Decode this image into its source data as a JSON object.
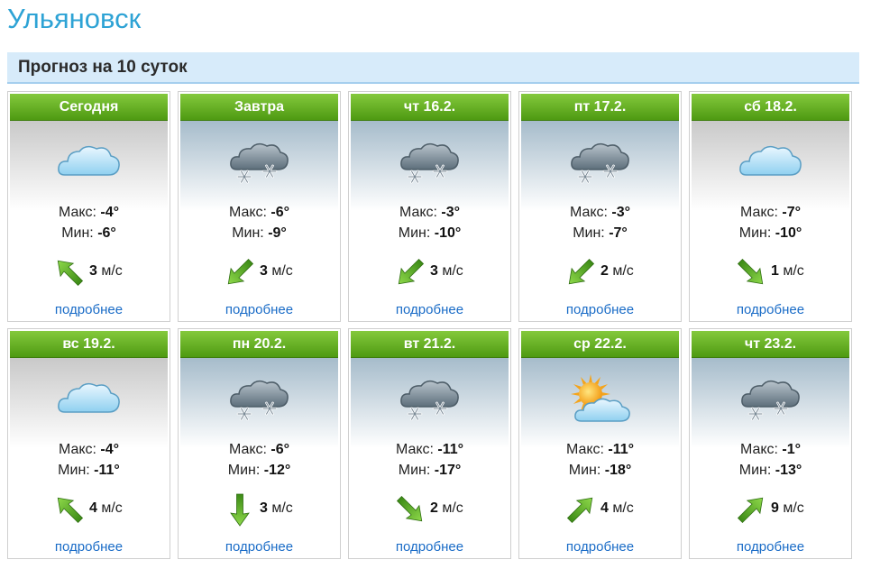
{
  "city": "Ульяновск",
  "section_title": "Прогноз на 10 суток",
  "labels": {
    "max": "Макс:",
    "min": "Мин:",
    "speed_unit": "м/с",
    "details": "подробнее"
  },
  "days": [
    {
      "date": "Сегодня",
      "icon": "cloud-icon",
      "max": "-4°",
      "min": "-6°",
      "wind_dir": "northwest",
      "wind": "3"
    },
    {
      "date": "Завтра",
      "icon": "snow-cloud-icon",
      "max": "-6°",
      "min": "-9°",
      "wind_dir": "southwest",
      "wind": "3"
    },
    {
      "date": "чт 16.2.",
      "icon": "snow-cloud-icon",
      "max": "-3°",
      "min": "-10°",
      "wind_dir": "southwest",
      "wind": "3"
    },
    {
      "date": "пт 17.2.",
      "icon": "snow-cloud-icon",
      "max": "-3°",
      "min": "-7°",
      "wind_dir": "southwest",
      "wind": "2"
    },
    {
      "date": "сб 18.2.",
      "icon": "cloud-icon",
      "max": "-7°",
      "min": "-10°",
      "wind_dir": "southeast",
      "wind": "1"
    },
    {
      "date": "вс 19.2.",
      "icon": "cloud-icon",
      "max": "-4°",
      "min": "-11°",
      "wind_dir": "northwest",
      "wind": "4"
    },
    {
      "date": "пн 20.2.",
      "icon": "snow-cloud-icon",
      "max": "-6°",
      "min": "-12°",
      "wind_dir": "south",
      "wind": "3"
    },
    {
      "date": "вт 21.2.",
      "icon": "snow-cloud-icon",
      "max": "-11°",
      "min": "-17°",
      "wind_dir": "southeast",
      "wind": "2"
    },
    {
      "date": "ср 22.2.",
      "icon": "sun-cloud-icon",
      "max": "-11°",
      "min": "-18°",
      "wind_dir": "northeast",
      "wind": "4"
    },
    {
      "date": "чт 23.2.",
      "icon": "snow-cloud-icon",
      "max": "-1°",
      "min": "-13°",
      "wind_dir": "northeast",
      "wind": "9"
    }
  ]
}
